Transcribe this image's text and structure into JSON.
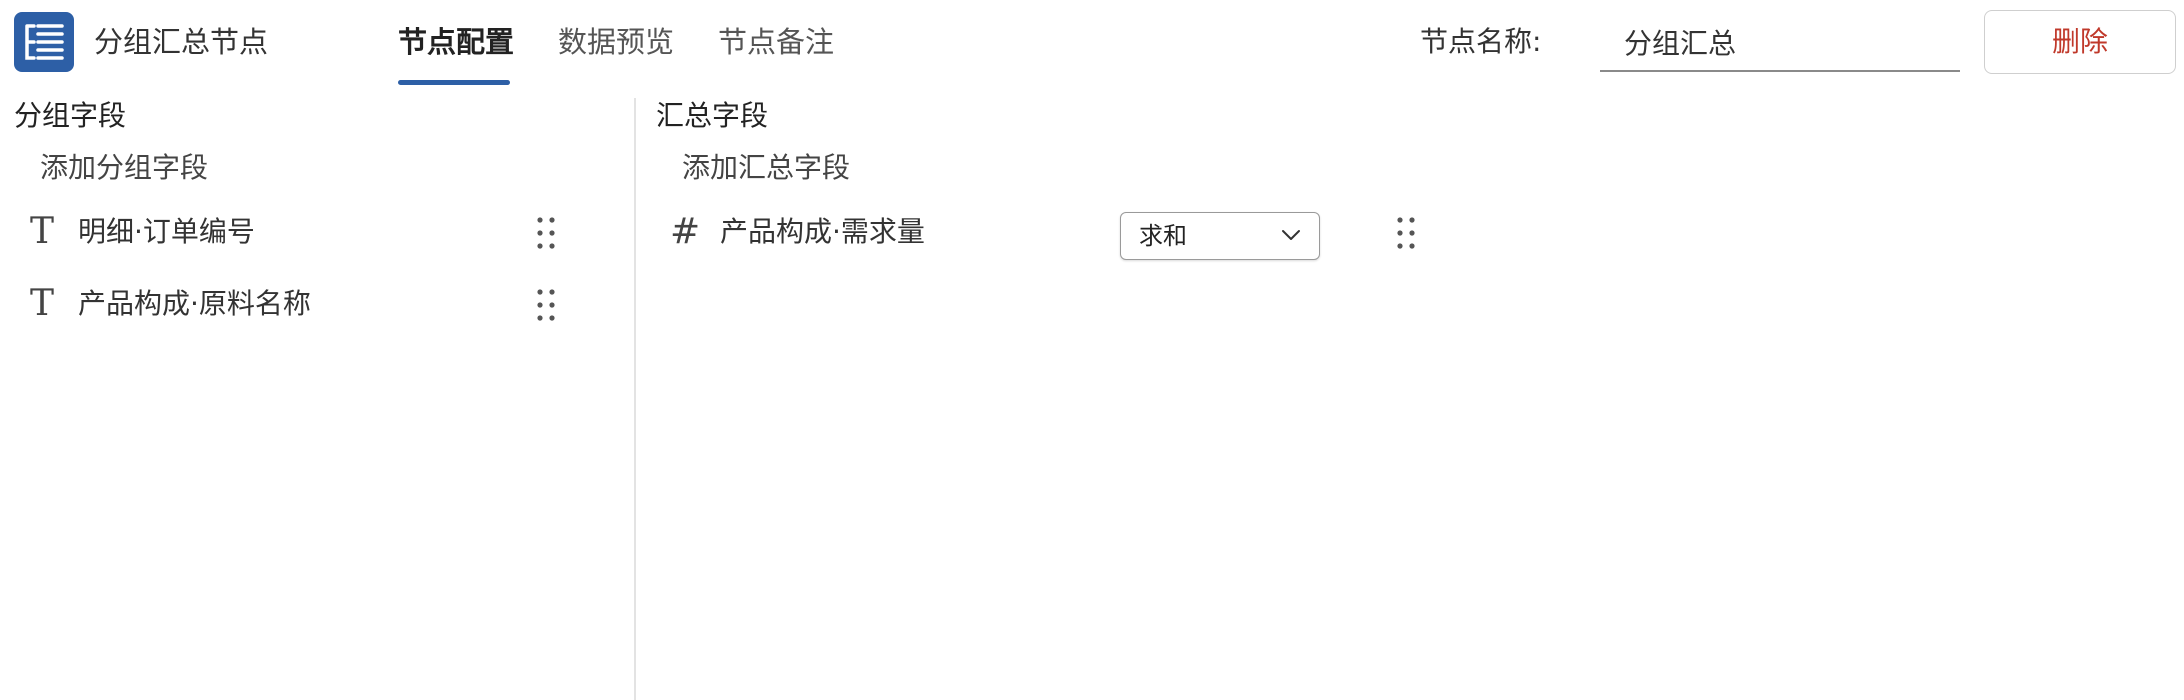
{
  "header": {
    "icon": "list-tree-icon",
    "node_title": "分组汇总节点",
    "tabs": [
      {
        "label": "节点配置",
        "active": true
      },
      {
        "label": "数据预览",
        "active": false
      },
      {
        "label": "节点备注",
        "active": false
      }
    ],
    "name_label": "节点名称:",
    "name_value": "分组汇总",
    "delete_label": "删除"
  },
  "group_panel": {
    "title": "分组字段",
    "add_label": "添加分组字段",
    "fields": [
      {
        "type_icon": "T",
        "label": "明细·订单编号"
      },
      {
        "type_icon": "T",
        "label": "产品构成·原料名称"
      }
    ]
  },
  "summary_panel": {
    "title": "汇总字段",
    "add_label": "添加汇总字段",
    "fields": [
      {
        "type_icon": "#",
        "label": "产品构成·需求量",
        "aggregate": "求和"
      }
    ]
  },
  "colors": {
    "accent": "#2d5fa6",
    "danger": "#c0392b"
  }
}
